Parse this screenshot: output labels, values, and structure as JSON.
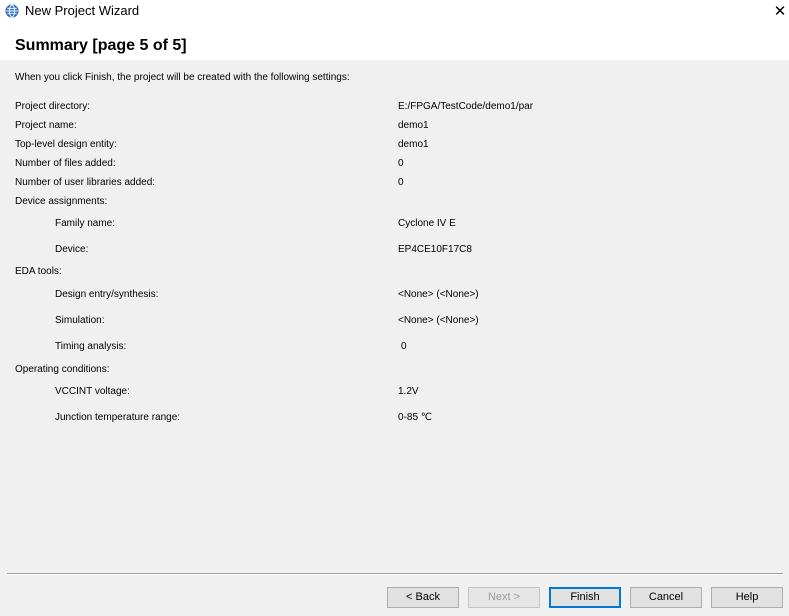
{
  "window": {
    "title": "New Project Wizard",
    "close_glyph": "✕",
    "icon": "globe-app-icon"
  },
  "header": {
    "title": "Summary [page 5 of 5]"
  },
  "intro": "When you click Finish, the project will be created with the following settings:",
  "settings": [
    {
      "label": "Project directory:",
      "value": "E:/FPGA/TestCode/demo1/par"
    },
    {
      "label": "Project name:",
      "value": "demo1"
    },
    {
      "label": "Top-level design entity:",
      "value": "demo1"
    },
    {
      "label": "Number of files added:",
      "value": "0"
    },
    {
      "label": "Number of user libraries added:",
      "value": "0"
    },
    {
      "label": "Device assignments:",
      "value": ""
    },
    {
      "label": "Family name:",
      "value": "Cyclone IV E"
    },
    {
      "label": "Device:",
      "value": "EP4CE10F17C8"
    },
    {
      "label": "EDA tools:",
      "value": ""
    },
    {
      "label": "Design entry/synthesis:",
      "value": "<None> (<None>)"
    },
    {
      "label": "Simulation:",
      "value": "<None> (<None>)"
    },
    {
      "label": "Timing analysis:",
      "value": "0"
    },
    {
      "label": "Operating conditions:",
      "value": ""
    },
    {
      "label": "VCCINT voltage:",
      "value": "1.2V"
    },
    {
      "label": "Junction temperature range:",
      "value": "0-85 ℃"
    }
  ],
  "buttons": {
    "back": "< Back",
    "next": "Next >",
    "finish": "Finish",
    "cancel": "Cancel",
    "help": "Help"
  }
}
